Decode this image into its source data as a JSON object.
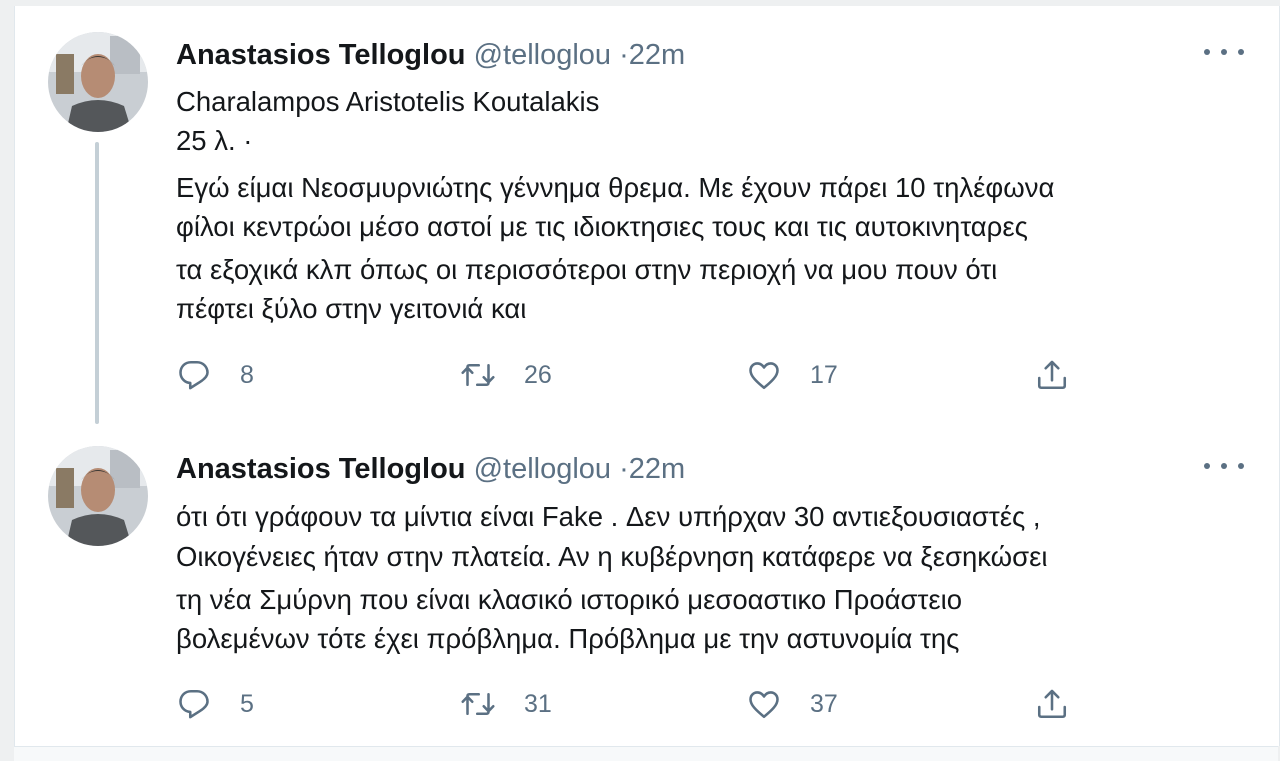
{
  "tweets": [
    {
      "author": "Anastasios Telloglou",
      "handle": "@telloglou",
      "separator": "·",
      "time": "22m",
      "lines": [
        "Charalampos Aristotelis Koutalakis",
        "25 λ.  ·",
        "Εγώ είμαι Νεοσμυρνιώτης γέννημα θρεμα. Με έχουν πάρει 10 τηλέφωνα",
        "φίλοι κεντρώοι μέσο αστοί με τις ιδιοκτησιες τους και τις αυτοκινηταρες",
        "τα εξοχικά κλπ όπως οι περισσότεροι στην περιοχή να μου πουν ότι",
        "πέφτει ξύλο στην γειτονιά και"
      ],
      "replies": "8",
      "retweets": "26",
      "likes": "17"
    },
    {
      "author": "Anastasios Telloglou",
      "handle": "@telloglou",
      "separator": "·",
      "time": "22m",
      "lines": [
        "ότι ότι γράφουν τα μίντια είναι Fake . Δεν υπήρχαν 30 αντιεξουσιαστές ,",
        "Οικογένειες  ήταν στην πλατεία. Αν η κυβέρνηση  κατάφερε να ξεσηκώσει",
        "τη νέα Σμύρνη που είναι κλασικό ιστορικό μεσοαστικο Προάστειο",
        "βολεμένων τότε έχει πρόβλημα. Πρόβλημα με την αστυνομία της"
      ],
      "replies": "5",
      "retweets": "31",
      "likes": "37"
    }
  ],
  "icons": {
    "reply": "reply-icon",
    "retweet": "retweet-icon",
    "like": "like-icon",
    "share": "share-icon",
    "more": "more-options-icon"
  },
  "colors": {
    "text": "#14171a",
    "secondary": "#5b7083",
    "thread_line": "#c4cfd6"
  }
}
